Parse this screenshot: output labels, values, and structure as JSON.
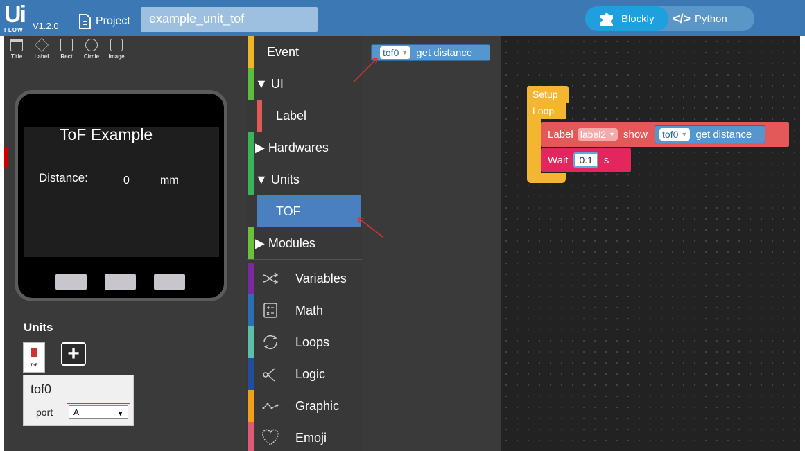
{
  "header": {
    "logo_main": "Ui",
    "logo_sub": "FLOW",
    "version": "V1.2.0",
    "project_label": "Project",
    "project_name": "example_unit_tof",
    "mode_blockly": "Blockly",
    "mode_python": "Python",
    "mode_python_icon": "</>"
  },
  "tools": [
    {
      "label": "Title",
      "icon": "title-icon"
    },
    {
      "label": "Label",
      "icon": "label-icon"
    },
    {
      "label": "Rect",
      "icon": "rect-icon"
    },
    {
      "label": "Circle",
      "icon": "circle-icon"
    },
    {
      "label": "Image",
      "icon": "image-icon"
    }
  ],
  "screen": {
    "title": "ToF Example",
    "distance_label": "Distance:",
    "distance_value": "0",
    "distance_unit": "mm"
  },
  "units": {
    "title": "Units",
    "thumb_label": "ToF",
    "add_symbol": "+",
    "card_name": "tof0",
    "port_label": "port",
    "port_value": "A",
    "port_arrow": "▼"
  },
  "toolbox": [
    {
      "label": "Event",
      "color": "#f0b429"
    },
    {
      "label": "▼ UI",
      "color": "#5cbd3a"
    },
    {
      "label": "Label",
      "color": "#e05a53"
    },
    {
      "label": "▶ Hardwares",
      "color": "#3cb35a"
    },
    {
      "label": "▼ Units",
      "color": "#3cb35a"
    },
    {
      "label": "TOF",
      "color": "#4a80c0"
    },
    {
      "label": "▶ Modules",
      "color": "#6ac23a"
    },
    {
      "label": "Variables",
      "color": "#7a2a9c",
      "icon": "shuffle-icon"
    },
    {
      "label": "Math",
      "color": "#2a6fb3",
      "icon": "calculator-icon"
    },
    {
      "label": "Loops",
      "color": "#5dbfa8",
      "icon": "loop-icon"
    },
    {
      "label": "Logic",
      "color": "#1f4f9a",
      "icon": "logic-icon"
    },
    {
      "label": "Graphic",
      "color": "#f0a01c",
      "icon": "graphic-icon"
    },
    {
      "label": "Emoji",
      "color": "#e05a78",
      "icon": "heart-icon"
    }
  ],
  "flyout_block": {
    "dropdown": "tof0",
    "text": "get distance"
  },
  "workspace": {
    "setup": "Setup",
    "loop": "Loop",
    "label_kw": "Label",
    "label_dd": "label2",
    "show_kw": "show",
    "tof_dd": "tof0",
    "get_distance": "get distance",
    "wait_kw": "Wait",
    "wait_value": "0.1",
    "wait_unit": "s"
  },
  "colors": {
    "header": "#3c78b4",
    "setup_block": "#f4b631",
    "label_block": "#e3595a",
    "wait_block": "#e3265d",
    "tof_block": "#5596cf"
  }
}
